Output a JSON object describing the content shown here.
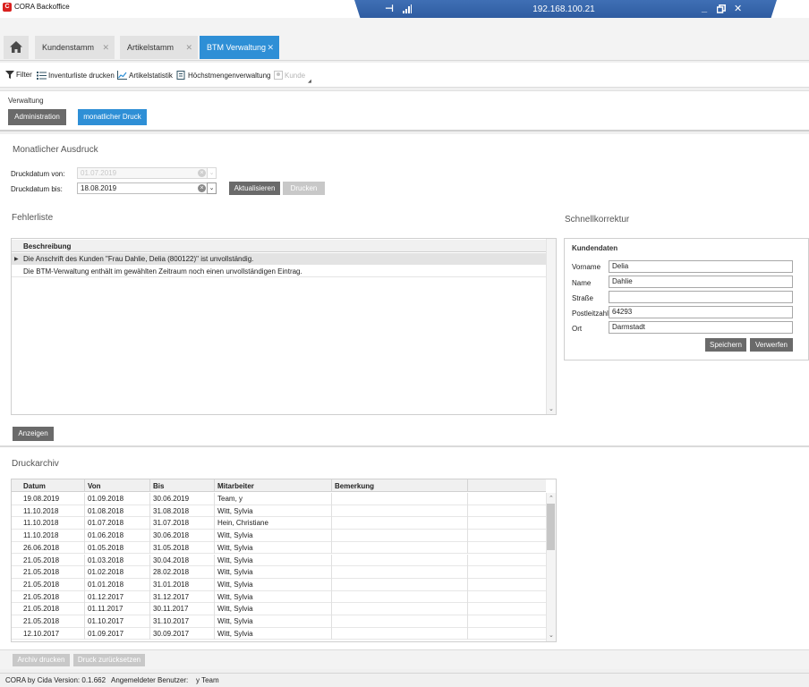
{
  "window": {
    "app_logo": "C",
    "title": "CORA Backoffice",
    "remote_ip": "192.168.100.21"
  },
  "tabs": [
    {
      "label": "Kundenstamm",
      "active": false
    },
    {
      "label": "Artikelstamm",
      "active": false
    },
    {
      "label": "BTM Verwaltung",
      "active": true
    }
  ],
  "toolbar": {
    "filter": "Filter",
    "inventurliste": "Inventurliste drucken",
    "artikelstatistik": "Artikelstatistik",
    "hoechstmengen": "Höchstmengenverwaltung",
    "kunde": "Kunde"
  },
  "verwaltung": {
    "label": "Verwaltung",
    "administration": "Administration",
    "monatlicher_druck": "monatlicher Druck"
  },
  "ausdruck": {
    "title": "Monatlicher Ausdruck",
    "von_label": "Druckdatum von:",
    "von_value": "01.07.2019",
    "bis_label": "Druckdatum bis:",
    "bis_value": "18.08.2019",
    "aktualisieren": "Aktualisieren",
    "drucken": "Drucken"
  },
  "fehlerliste": {
    "title": "Fehlerliste",
    "column": "Beschreibung",
    "rows": [
      "Die Anschrift des Kunden \"Frau Dahlie, Delia (800122)\" ist unvollständig.",
      "Die BTM-Verwaltung enthält im gewählten Zeitraum noch einen unvollständigen Eintrag."
    ],
    "anzeigen": "Anzeigen"
  },
  "schnellkorrektur": {
    "title": "Schnellkorrektur",
    "group": "Kundendaten",
    "fields": [
      {
        "label": "Vorname",
        "value": "Delia"
      },
      {
        "label": "Name",
        "value": "Dahlie"
      },
      {
        "label": "Straße",
        "value": ""
      },
      {
        "label": "Postleitzahl",
        "value": "64293"
      },
      {
        "label": "Ort",
        "value": "Darmstadt"
      }
    ],
    "speichern": "Speichern",
    "verwerfen": "Verwerfen"
  },
  "druckarchiv": {
    "title": "Druckarchiv",
    "columns": [
      "Datum",
      "Von",
      "Bis",
      "Mitarbeiter",
      "Bemerkung"
    ],
    "rows": [
      [
        "19.08.2019",
        "01.09.2018",
        "30.06.2019",
        "Team, y",
        ""
      ],
      [
        "11.10.2018",
        "01.08.2018",
        "31.08.2018",
        "Witt, Sylvia",
        ""
      ],
      [
        "11.10.2018",
        "01.07.2018",
        "31.07.2018",
        "Hein, Christiane",
        ""
      ],
      [
        "11.10.2018",
        "01.06.2018",
        "30.06.2018",
        "Witt, Sylvia",
        ""
      ],
      [
        "26.06.2018",
        "01.05.2018",
        "31.05.2018",
        "Witt, Sylvia",
        ""
      ],
      [
        "21.05.2018",
        "01.03.2018",
        "30.04.2018",
        "Witt, Sylvia",
        ""
      ],
      [
        "21.05.2018",
        "01.02.2018",
        "28.02.2018",
        "Witt, Sylvia",
        ""
      ],
      [
        "21.05.2018",
        "01.01.2018",
        "31.01.2018",
        "Witt, Sylvia",
        ""
      ],
      [
        "21.05.2018",
        "01.12.2017",
        "31.12.2017",
        "Witt, Sylvia",
        ""
      ],
      [
        "21.05.2018",
        "01.11.2017",
        "30.11.2017",
        "Witt, Sylvia",
        ""
      ],
      [
        "21.05.2018",
        "01.10.2017",
        "31.10.2017",
        "Witt, Sylvia",
        ""
      ],
      [
        "12.10.2017",
        "01.09.2017",
        "30.09.2017",
        "Witt, Sylvia",
        ""
      ]
    ],
    "archiv_drucken": "Archiv drucken",
    "druck_zuruecksetzen": "Druck zurücksetzen"
  },
  "status": {
    "version": "CORA by Cida Version: 0.1.662",
    "user_label": "Angemeldeter Benutzer:",
    "user_value": "y Team"
  },
  "colors": {
    "accent": "#2e8fd6",
    "button_dark": "#6a6a6a",
    "button_disabled": "#c8c8c8",
    "logo_red": "#d9211f"
  }
}
